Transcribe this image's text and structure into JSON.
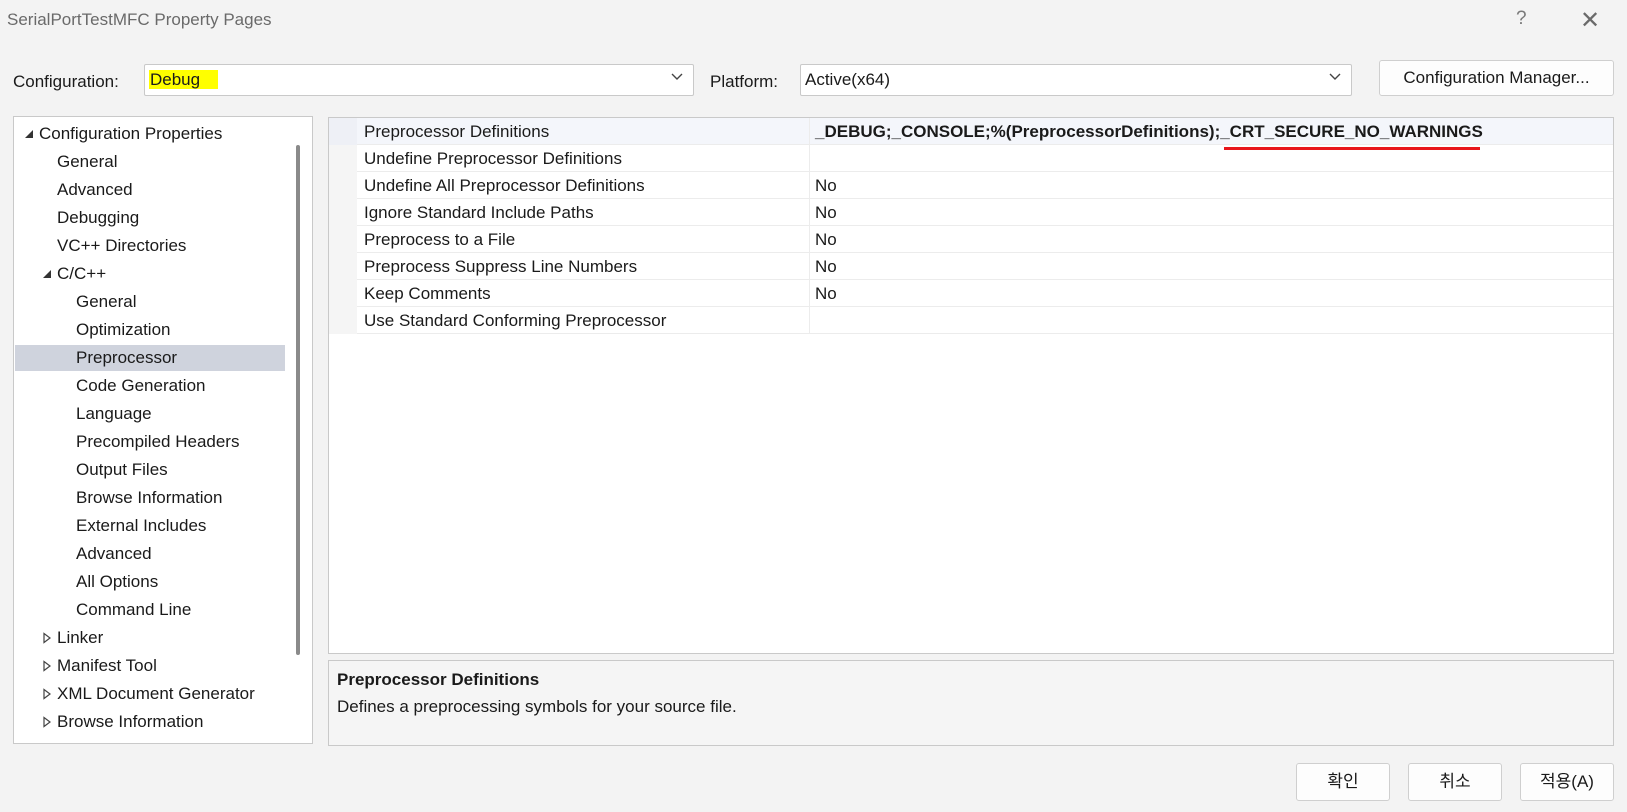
{
  "window": {
    "title": "SerialPortTestMFC Property Pages",
    "help_glyph": "?",
    "close_glyph": "✕"
  },
  "toolbar": {
    "configuration_label": "Configuration:",
    "configuration_value": "Debug",
    "platform_label": "Platform:",
    "platform_value": "Active(x64)",
    "config_manager_label": "Configuration Manager..."
  },
  "tree": {
    "items": [
      {
        "label": "Configuration Properties",
        "level": 0,
        "expander": "expanded"
      },
      {
        "label": "General",
        "level": 1
      },
      {
        "label": "Advanced",
        "level": 1
      },
      {
        "label": "Debugging",
        "level": 1
      },
      {
        "label": "VC++ Directories",
        "level": 1
      },
      {
        "label": "C/C++",
        "level": 1,
        "expander": "expanded"
      },
      {
        "label": "General",
        "level": 2
      },
      {
        "label": "Optimization",
        "level": 2
      },
      {
        "label": "Preprocessor",
        "level": 2,
        "selected": true
      },
      {
        "label": "Code Generation",
        "level": 2
      },
      {
        "label": "Language",
        "level": 2
      },
      {
        "label": "Precompiled Headers",
        "level": 2
      },
      {
        "label": "Output Files",
        "level": 2
      },
      {
        "label": "Browse Information",
        "level": 2
      },
      {
        "label": "External Includes",
        "level": 2
      },
      {
        "label": "Advanced",
        "level": 2
      },
      {
        "label": "All Options",
        "level": 2
      },
      {
        "label": "Command Line",
        "level": 2
      },
      {
        "label": "Linker",
        "level": 1,
        "expander": "collapsed"
      },
      {
        "label": "Manifest Tool",
        "level": 1,
        "expander": "collapsed"
      },
      {
        "label": "XML Document Generator",
        "level": 1,
        "expander": "collapsed"
      },
      {
        "label": "Browse Information",
        "level": 1,
        "expander": "collapsed"
      }
    ]
  },
  "grid": {
    "rows": [
      {
        "name": "Preprocessor Definitions",
        "value": "_DEBUG;_CONSOLE;%(PreprocessorDefinitions);_CRT_SECURE_NO_WARNINGS",
        "selected": true
      },
      {
        "name": "Undefine Preprocessor Definitions",
        "value": ""
      },
      {
        "name": "Undefine All Preprocessor Definitions",
        "value": "No"
      },
      {
        "name": "Ignore Standard Include Paths",
        "value": "No"
      },
      {
        "name": "Preprocess to a File",
        "value": "No"
      },
      {
        "name": "Preprocess Suppress Line Numbers",
        "value": "No"
      },
      {
        "name": "Keep Comments",
        "value": "No"
      },
      {
        "name": "Use Standard Conforming Preprocessor",
        "value": ""
      }
    ]
  },
  "description": {
    "title": "Preprocessor Definitions",
    "text": "Defines a preprocessing symbols for your source file."
  },
  "footer": {
    "ok_label": "확인",
    "cancel_label": "취소",
    "apply_label": "적용(A)"
  },
  "colors": {
    "highlight": "#ffff00",
    "annotation_underline": "#e8161b",
    "selection": "#cfd3dd"
  }
}
